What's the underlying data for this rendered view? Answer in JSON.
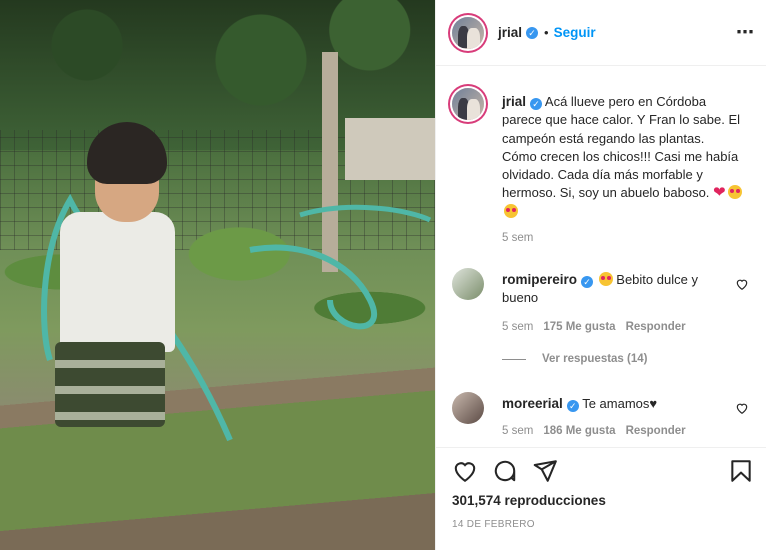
{
  "header": {
    "username": "jrial",
    "verified": "✓",
    "separator": "•",
    "follow_label": "Seguir",
    "more_icon": "⋯"
  },
  "caption": {
    "username": "jrial",
    "text": "Acá llueve pero en Córdoba parece que hace calor. Y Fran lo sabe. El campeón está regando las plantas. Cómo crecen los chicos!!! Casi me había olvidado. Cada día más morfable y hermoso. Si, soy un abuelo baboso.",
    "emojis": [
      "heart",
      "smiling-face-with-hearts",
      "heart-eyes"
    ],
    "time": "5 sem"
  },
  "comments": [
    {
      "username": "romipereiro",
      "text": "Bebito dulce y bueno",
      "time": "5 sem",
      "likes": "175 Me gusta",
      "reply_label": "Responder",
      "view_replies": "Ver respuestas (14)"
    },
    {
      "username": "moreerial",
      "text": "Te amamos♥",
      "time": "5 sem",
      "likes": "186 Me gusta",
      "reply_label": "Responder"
    }
  ],
  "actions": {
    "icons": [
      "heart-icon",
      "comment-icon",
      "share-icon",
      "bookmark-icon"
    ],
    "views": "301,574 reproducciones",
    "date": "14 DE FEBRERO"
  },
  "colors": {
    "link_blue": "#0095f6",
    "verified_blue": "#3897f0",
    "muted": "#8e8e8e",
    "text": "#262626",
    "story_ring": "#d83c7a"
  }
}
